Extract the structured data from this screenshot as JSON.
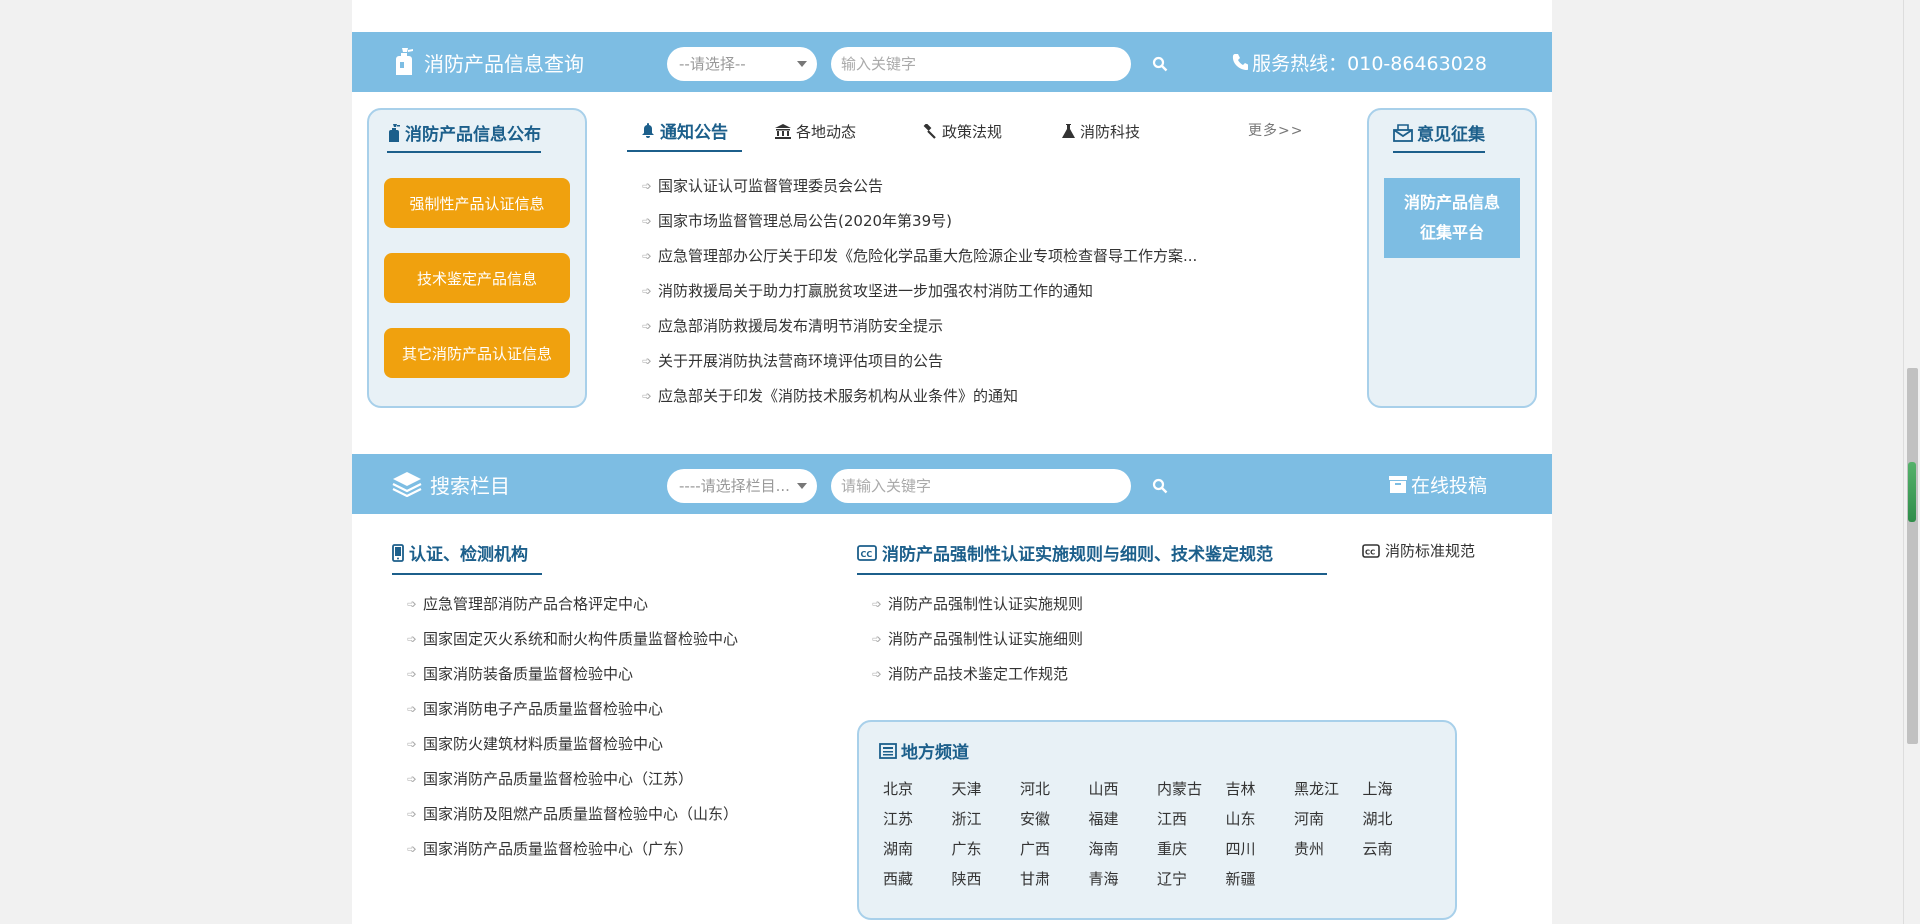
{
  "query_bar": {
    "title": "消防产品信息查询",
    "select_value": "--请选择--",
    "keyword_placeholder": "输入关键字",
    "hotline": "服务热线：010-86463028"
  },
  "publish_box": {
    "title": "消防产品信息公布",
    "buttons": [
      "强制性产品认证信息",
      "技术鉴定产品信息",
      "其它消防产品认证信息"
    ]
  },
  "tabs": [
    {
      "label": "通知公告",
      "icon": "bell-icon"
    },
    {
      "label": "各地动态",
      "icon": "bank-icon"
    },
    {
      "label": "政策法规",
      "icon": "gavel-icon"
    },
    {
      "label": "消防科技",
      "icon": "flask-icon"
    }
  ],
  "more_label": "更多>>",
  "news": [
    "国家认证认可监督管理委员会公告",
    "国家市场监督管理总局公告(2020年第39号)",
    "应急管理部办公厅关于印发《危险化学品重大危险源企业专项检查督导工作方案...",
    "消防救援局关于助力打赢脱贫攻坚进一步加强农村消防工作的通知",
    "应急部消防救援局发布清明节消防安全提示",
    "关于开展消防执法营商环境评估项目的公告",
    "应急部关于印发《消防技术服务机构从业条件》的通知"
  ],
  "opinion_box": {
    "title": "意见征集",
    "button_line1": "消防产品信息",
    "button_line2": "征集平台"
  },
  "search_bar": {
    "title": "搜索栏目",
    "select_value": "----请选择栏目...",
    "keyword_placeholder": "请输入关键字",
    "submit_label": "在线投稿"
  },
  "institutions": {
    "title": "认证、检测机构",
    "items": [
      "应急管理部消防产品合格评定中心",
      "国家固定灭火系统和耐火构件质量监督检验中心",
      "国家消防装备质量监督检验中心",
      "国家消防电子产品质量监督检验中心",
      "国家防火建筑材料质量监督检验中心",
      "国家消防产品质量监督检验中心（江苏）",
      "国家消防及阻燃产品质量监督检验中心（山东）",
      "国家消防产品质量监督检验中心（广东）"
    ]
  },
  "rules": {
    "title": "消防产品强制性认证实施规则与细则、技术鉴定规范",
    "side_link": "消防标准规范",
    "items": [
      "消防产品强制性认证实施规则",
      "消防产品强制性认证实施细则",
      "消防产品技术鉴定工作规范"
    ]
  },
  "regions": {
    "title": "地方频道",
    "cities": [
      "北京",
      "天津",
      "河北",
      "山西",
      "内蒙古",
      "吉林",
      "黑龙江",
      "上海",
      "江苏",
      "浙江",
      "安徽",
      "福建",
      "江西",
      "山东",
      "河南",
      "湖北",
      "湖南",
      "广东",
      "广西",
      "海南",
      "重庆",
      "四川",
      "贵州",
      "云南",
      "西藏",
      "陕西",
      "甘肃",
      "青海",
      "辽宁",
      "新疆"
    ]
  }
}
